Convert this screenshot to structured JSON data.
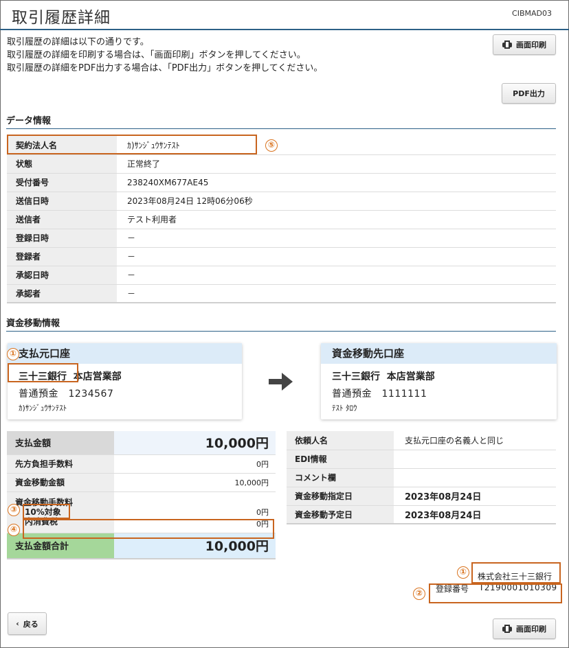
{
  "header": {
    "title": "取引履歴詳細",
    "screen_id": "CIBMAD03"
  },
  "intro": [
    "取引履歴の詳細は以下の通りです。",
    "取引履歴の詳細を印刷する場合は、「画面印刷」ボタンを押してください。",
    "取引履歴の詳細をPDF出力する場合は、「PDF出力」ボタンを押してください。"
  ],
  "buttons": {
    "print": "画面印刷",
    "pdf": "PDF出力",
    "back": "戻る"
  },
  "data_info": {
    "title": "データ情報",
    "rows": [
      {
        "label": "契約法人名",
        "value": "ｶ)ｻﾝｼﾞｭｳｻﾝﾃｽﾄ"
      },
      {
        "label": "状態",
        "value": "正常終了"
      },
      {
        "label": "受付番号",
        "value": "238240XM677AE45"
      },
      {
        "label": "送信日時",
        "value": "2023年08月24日 12時06分06秒"
      },
      {
        "label": "送信者",
        "value": "テスト利用者"
      },
      {
        "label": "登録日時",
        "value": "－"
      },
      {
        "label": "登録者",
        "value": "－"
      },
      {
        "label": "承認日時",
        "value": "－"
      },
      {
        "label": "承認者",
        "value": "－"
      }
    ]
  },
  "transfer": {
    "title": "資金移動情報",
    "source": {
      "header": "支払元口座",
      "bank": "三十三銀行",
      "branch": "本店営業部",
      "account": "普通預金　1234567",
      "holder": "ｶ)ｻﾝｼﾞｭｳｻﾝﾃｽﾄ"
    },
    "dest": {
      "header": "資金移動先口座",
      "bank": "三十三銀行",
      "branch": "本店営業部",
      "account": "普通預金　1111111",
      "holder": "ﾃｽﾄ ﾀﾛｳ"
    }
  },
  "amounts": {
    "payment_label": "支払金額",
    "payment_value": "10,000円",
    "prepaid_fee_label": "先方負担手数料",
    "prepaid_fee_value": "0円",
    "transfer_amount_label": "資金移動金額",
    "transfer_amount_value": "10,000円",
    "fee_label_1": "資金移動手数料",
    "fee_label_2": "10%対象",
    "fee_value": "0円",
    "tax_label": "内消費税",
    "tax_value": "0円",
    "total_label": "支払金額合計",
    "total_value": "10,000円"
  },
  "details": {
    "rows": [
      {
        "label": "依頼人名",
        "value": "支払元口座の名義人と同じ"
      },
      {
        "label": "EDI情報",
        "value": ""
      },
      {
        "label": "コメント欄",
        "value": ""
      },
      {
        "label": "資金移動指定日",
        "value": "2023年08月24日"
      },
      {
        "label": "資金移動予定日",
        "value": "2023年08月24日"
      }
    ]
  },
  "issuer": {
    "bank_name": "株式会社三十三銀行",
    "reg_label": "登録番号",
    "reg_number": "T2190001010309"
  },
  "annotations": [
    "①",
    "②",
    "③",
    "④",
    "⑤"
  ],
  "colors": {
    "accent_line": "#2b5f86",
    "annotation": "#c8641e",
    "card_header": "#dcebf8",
    "total_green": "#a5d79a"
  }
}
